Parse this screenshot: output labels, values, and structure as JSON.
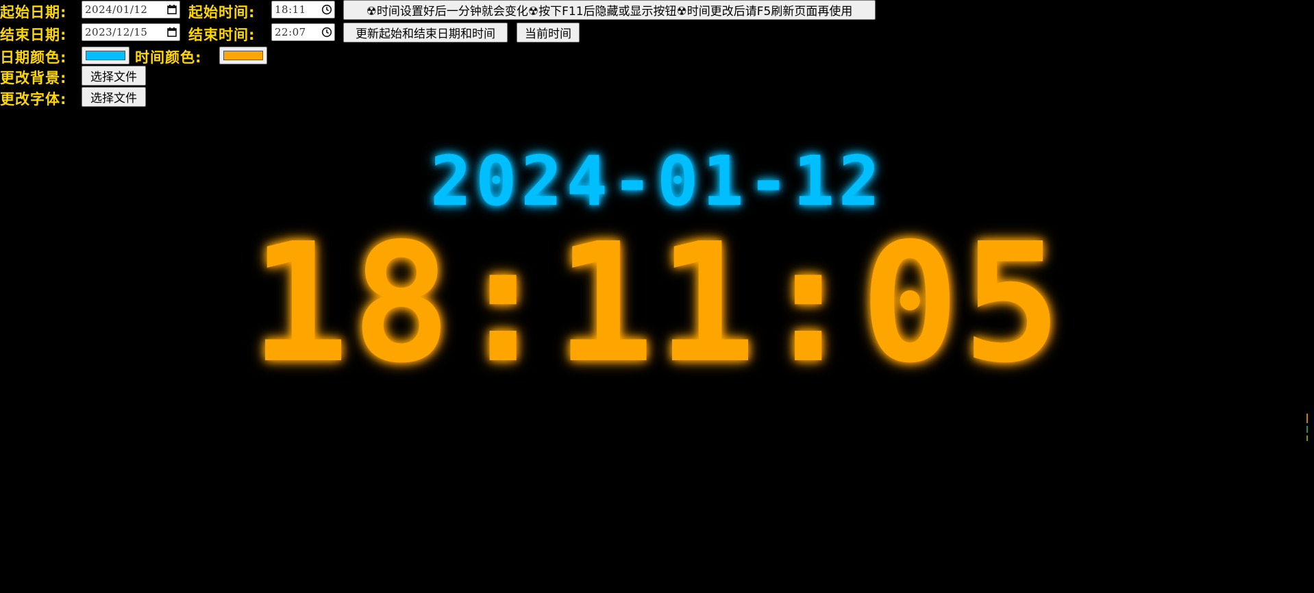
{
  "controls": {
    "start_date_label": "起始日期:",
    "start_date_value": "2024/01/12",
    "start_time_label": "起始时间:",
    "start_time_value": "18:11",
    "info_button": "☢时间设置好后一分钟就会变化☢按下F11后隐藏或显示按钮☢时间更改后请F5刷新页面再使用",
    "end_date_label": "结束日期:",
    "end_date_value": "2023/12/15",
    "end_time_label": "结束时间:",
    "end_time_value": "22:07",
    "update_button": "更新起始和结束日期和时间",
    "current_time_button": "当前时间",
    "date_color_label": "日期颜色:",
    "date_color": "#00bfff",
    "time_color_label": "时间颜色:",
    "time_color": "#ffa500",
    "background_label": "更改背景:",
    "background_button": "选择文件",
    "font_label": "更改字体:",
    "font_button": "选择文件",
    "calendar_icon": "calendar-icon",
    "clock_icon": "clock-icon"
  },
  "clock": {
    "date": "2024-01-12",
    "time": "18:11:05"
  },
  "colors": {
    "label": "#ffd700",
    "background": "#000000"
  }
}
